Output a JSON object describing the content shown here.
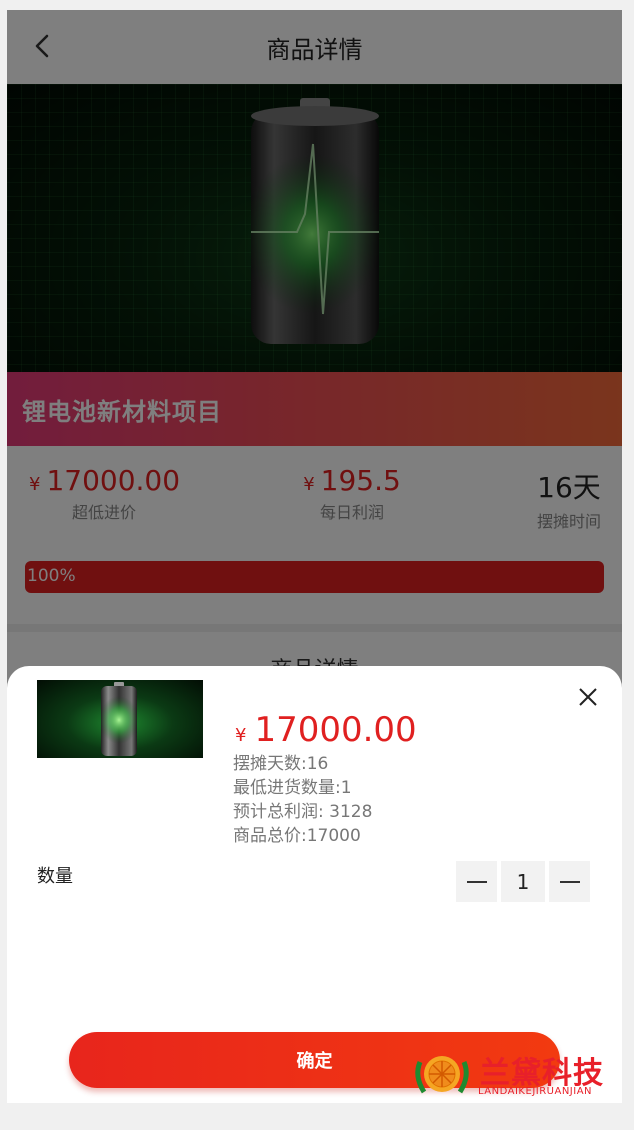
{
  "header": {
    "title": "商品详情",
    "back_icon": "chevron-left-icon"
  },
  "product": {
    "name": "锂电池新材料项目",
    "stats": [
      {
        "currency": "¥",
        "value": "17000.00",
        "label": "超低进价"
      },
      {
        "currency": "¥",
        "value": "195.5",
        "label": "每日利润"
      },
      {
        "value": "16天",
        "label": "摆摊时间"
      }
    ],
    "progress_text": "100%",
    "progress": 1.0,
    "detail_heading": "商品详情"
  },
  "sheet": {
    "currency": "¥",
    "price": "17000.00",
    "days": "摆摊天数:16",
    "min_qty": "最低进货数量:1",
    "total_profit": "预计总利润: 3128",
    "total_price": "商品总价:17000",
    "qty_label": "数量",
    "qty_value": "1",
    "confirm_label": "确定"
  },
  "watermark": {
    "text": "兰黛科技",
    "sub": "LANDAIKEJIRUANJIAN"
  },
  "colors": {
    "accent": "#e02020",
    "banner_green": "#0f3d18"
  }
}
